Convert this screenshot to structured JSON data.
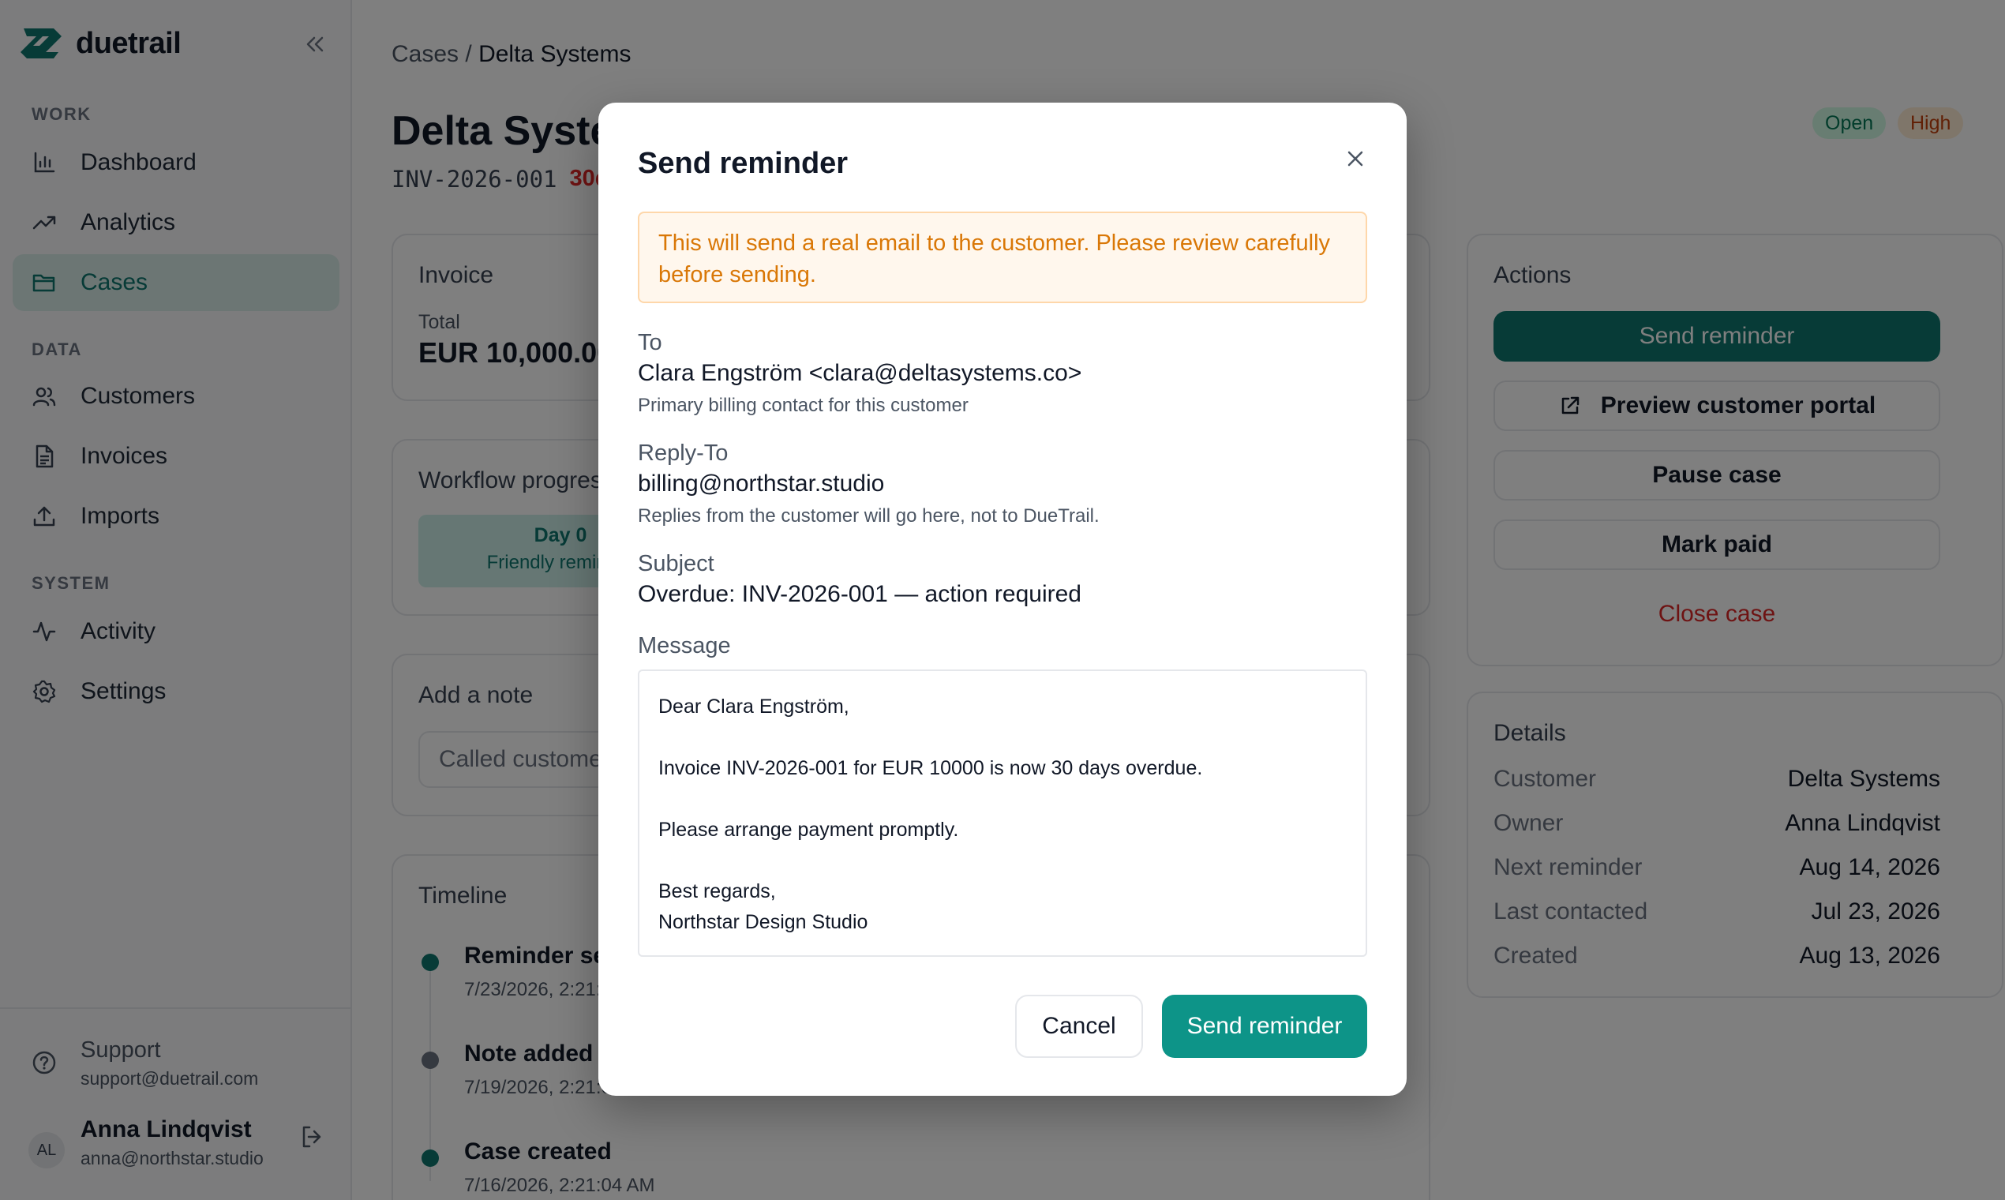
{
  "app": {
    "name": "duetrail"
  },
  "sidebar": {
    "sections": {
      "work": "WORK",
      "data": "DATA",
      "system": "SYSTEM"
    },
    "items": [
      {
        "label": "Dashboard",
        "icon": "bar-chart-icon"
      },
      {
        "label": "Analytics",
        "icon": "trending-up-icon"
      },
      {
        "label": "Cases",
        "icon": "folder-icon",
        "active": true
      },
      {
        "label": "Customers",
        "icon": "users-icon"
      },
      {
        "label": "Invoices",
        "icon": "file-text-icon"
      },
      {
        "label": "Imports",
        "icon": "upload-icon"
      },
      {
        "label": "Activity",
        "icon": "activity-icon"
      },
      {
        "label": "Settings",
        "icon": "gear-icon"
      }
    ],
    "support": {
      "title": "Support",
      "email": "support@duetrail.com"
    },
    "user": {
      "initials": "AL",
      "name": "Anna Lindqvist",
      "email": "anna@northstar.studio"
    }
  },
  "breadcrumb": {
    "parent": "Cases",
    "separator": "/",
    "current": "Delta Systems"
  },
  "case": {
    "title": "Delta Systems",
    "invoice_id": "INV-2026-001",
    "overdue": "30d",
    "status": "Open",
    "priority": "High"
  },
  "invoice_card": {
    "title": "Invoice",
    "total_label": "Total",
    "total": "EUR 10,000.00"
  },
  "workflow_card": {
    "title": "Workflow progress",
    "step_title": "Day 0",
    "step_sub": "Friendly reminder"
  },
  "note_card": {
    "title": "Add a note",
    "placeholder": "Called customer..."
  },
  "timeline": {
    "title": "Timeline",
    "items": [
      {
        "title": "Reminder sent",
        "time": "7/23/2026, 2:21:04 AM"
      },
      {
        "title": "Note added",
        "time": "7/19/2026, 2:21:04 AM"
      },
      {
        "title": "Case created",
        "time": "7/16/2026, 2:21:04 AM"
      }
    ]
  },
  "actions": {
    "title": "Actions",
    "send_reminder": "Send reminder",
    "preview_portal": "Preview customer portal",
    "pause_case": "Pause case",
    "mark_paid": "Mark paid",
    "close_case": "Close case"
  },
  "details": {
    "title": "Details",
    "rows": [
      {
        "label": "Customer",
        "value": "Delta Systems"
      },
      {
        "label": "Owner",
        "value": "Anna Lindqvist"
      },
      {
        "label": "Next reminder",
        "value": "Aug 14, 2026"
      },
      {
        "label": "Last contacted",
        "value": "Jul 23, 2026"
      },
      {
        "label": "Created",
        "value": "Aug 13, 2026"
      }
    ]
  },
  "modal": {
    "title": "Send reminder",
    "warning": "This will send a real email to the customer. Please review carefully before sending.",
    "to_label": "To",
    "to_value": "Clara Engström <clara@deltasystems.co>",
    "to_hint": "Primary billing contact for this customer",
    "reply_label": "Reply-To",
    "reply_value": "billing@northstar.studio",
    "reply_hint": "Replies from the customer will go here, not to DueTrail.",
    "subject_label": "Subject",
    "subject_value": "Overdue: INV-2026-001 — action required",
    "message_label": "Message",
    "message_body": "Dear Clara Engström,\n\nInvoice INV-2026-001 for EUR 10000 is now 30 days overdue.\n\nPlease arrange payment promptly.\n\nBest regards,\nNorthstar Design Studio",
    "cancel": "Cancel",
    "send": "Send reminder"
  },
  "colors": {
    "accent": "#0f766e",
    "accent_button": "#0d9488",
    "warning": "#d97706",
    "danger": "#dc2626"
  }
}
